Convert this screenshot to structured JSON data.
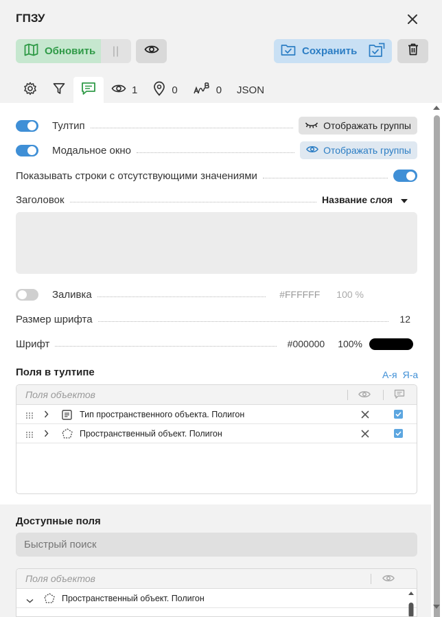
{
  "window": {
    "title": "ГПЗУ"
  },
  "toolbar": {
    "update_label": "Обновить",
    "pause_label": "||",
    "save_label": "Сохранить"
  },
  "tabs": [
    {
      "name": "settings",
      "label": ""
    },
    {
      "name": "filter",
      "label": ""
    },
    {
      "name": "tooltip",
      "label": ""
    },
    {
      "name": "visible",
      "label": "1"
    },
    {
      "name": "location",
      "label": "0"
    },
    {
      "name": "labels",
      "label": "0"
    },
    {
      "name": "json",
      "label": "JSON"
    }
  ],
  "settings": {
    "tooltip": {
      "label": "Тултип",
      "enabled": true,
      "groups_label": "Отображать группы"
    },
    "modal": {
      "label": "Модальное окно",
      "enabled": true,
      "groups_label": "Отображать группы"
    },
    "show_empty": {
      "label": "Показывать строки с отсутствующими значениями",
      "enabled": true
    },
    "heading": {
      "label": "Заголовок",
      "value": "Название слоя"
    },
    "fill": {
      "label": "Заливка",
      "enabled": false,
      "color": "#FFFFFF",
      "opacity": "100 %"
    },
    "font_size": {
      "label": "Размер шрифта",
      "value": "12"
    },
    "font": {
      "label": "Шрифт",
      "color": "#000000",
      "opacity": "100%",
      "swatch": "#000000"
    }
  },
  "tooltip_fields": {
    "title": "Поля в тултипе",
    "sort_az": "А-я",
    "sort_za": "Я-а",
    "header": "Поля объектов",
    "rows": [
      {
        "label": "Тип пространственного объекта. Полигон",
        "checked": true
      },
      {
        "label": "Пространственный объект. Полигон",
        "checked": true
      }
    ]
  },
  "available_fields": {
    "title": "Доступные поля",
    "search_placeholder": "Быстрый поиск",
    "header": "Поля объектов",
    "rows": [
      {
        "label": "Пространственный объект. Полигон"
      }
    ]
  },
  "colors": {
    "accent_blue": "#3f8fd6",
    "green": "#2f9a47",
    "green_bg": "#c6e7cf",
    "save_bg": "#c9e0f4"
  }
}
